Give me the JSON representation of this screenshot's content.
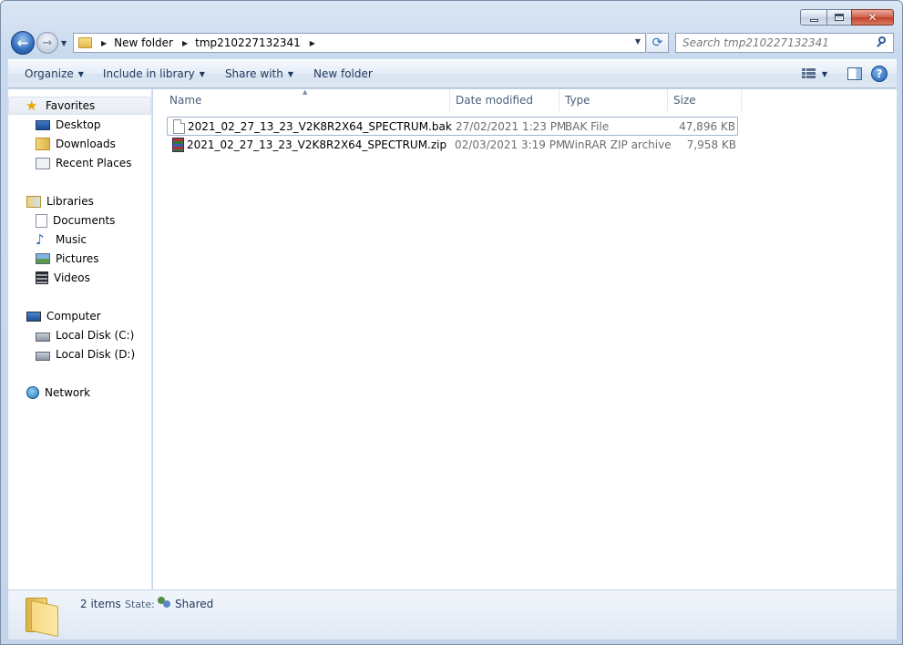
{
  "window": {
    "caption": {
      "minimize_icon": "minimize-icon",
      "maximize_icon": "maximize-icon",
      "close_icon": "close-icon"
    }
  },
  "navigation": {
    "breadcrumbs": [
      "New folder",
      "tmp210227132341"
    ],
    "search_placeholder": "Search tmp210227132341"
  },
  "toolbar": {
    "organize": "Organize",
    "include_in_library": "Include in library",
    "share_with": "Share with",
    "new_folder": "New folder"
  },
  "sidebar": {
    "favorites": {
      "label": "Favorites",
      "items": [
        "Desktop",
        "Downloads",
        "Recent Places"
      ]
    },
    "libraries": {
      "label": "Libraries",
      "items": [
        "Documents",
        "Music",
        "Pictures",
        "Videos"
      ]
    },
    "computer": {
      "label": "Computer",
      "items": [
        "Local Disk (C:)",
        "Local Disk (D:)"
      ]
    },
    "network": {
      "label": "Network"
    }
  },
  "columns": {
    "name": "Name",
    "date": "Date modified",
    "type": "Type",
    "size": "Size"
  },
  "files": [
    {
      "name": "2021_02_27_13_23_V2K8R2X64_SPECTRUM.bak",
      "date": "27/02/2021 1:23 PM",
      "type": "BAK File",
      "size": "47,896 KB",
      "icon": "document-icon"
    },
    {
      "name": "2021_02_27_13_23_V2K8R2X64_SPECTRUM.zip",
      "date": "02/03/2021 3:19 PM",
      "type": "WinRAR ZIP archive",
      "size": "7,958 KB",
      "icon": "winrar-archive-icon"
    }
  ],
  "status": {
    "item_count": "2 items",
    "state_label": "State:",
    "state_value": "Shared"
  },
  "colors": {
    "accent": "#1e395b",
    "selection_border": "#9fb6d2"
  }
}
